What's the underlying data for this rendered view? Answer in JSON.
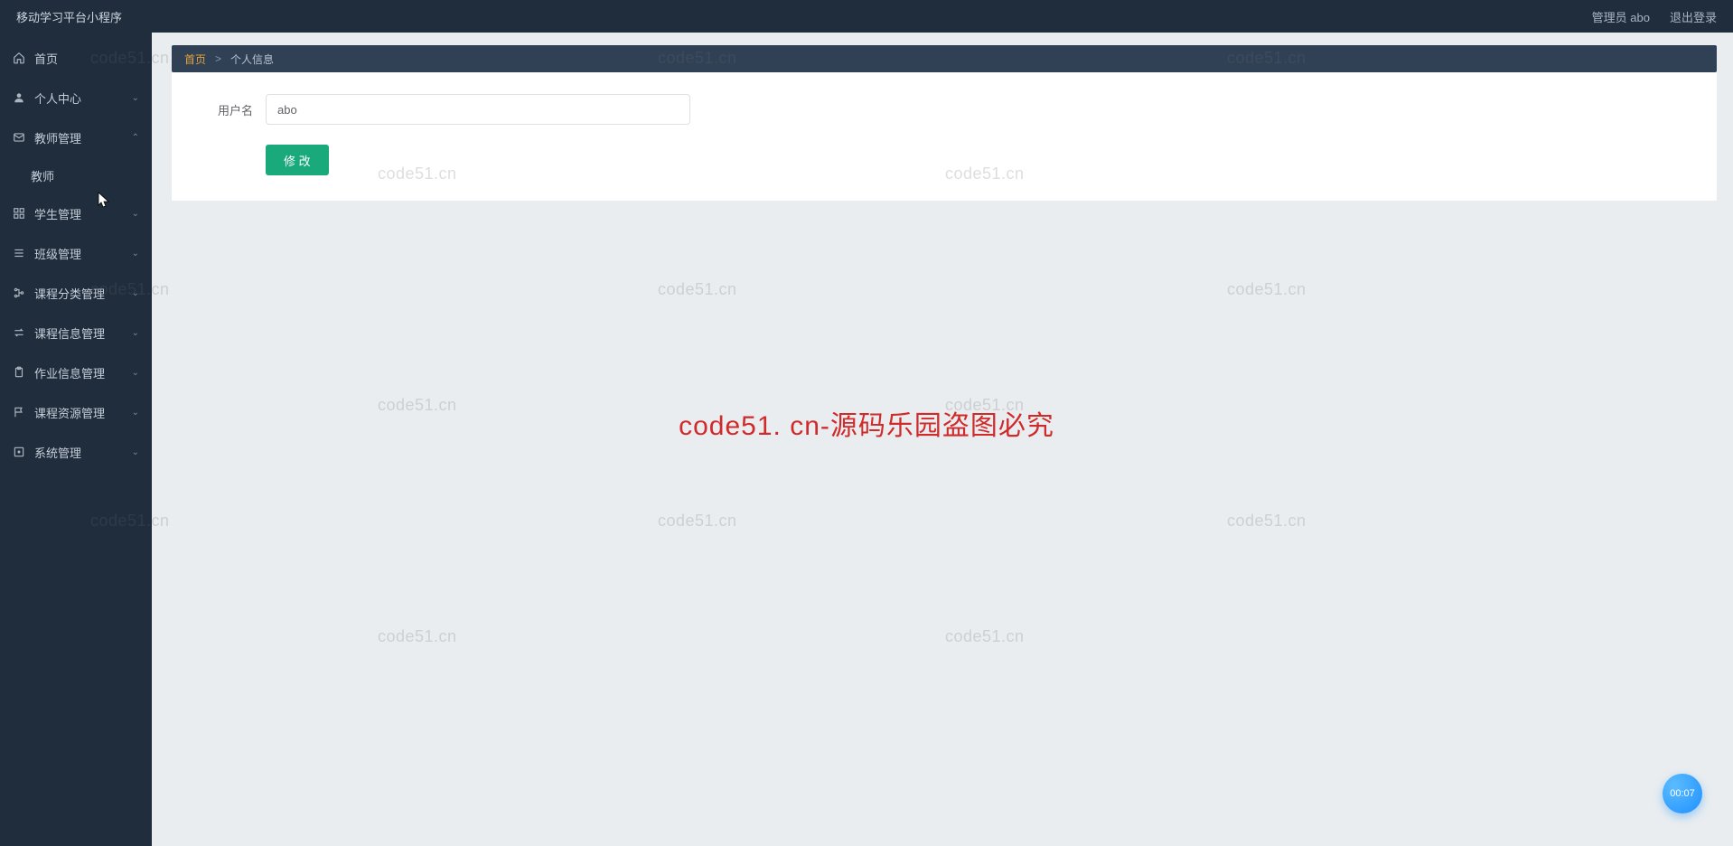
{
  "header": {
    "title": "移动学习平台小程序",
    "admin_label": "管理员 abo",
    "logout_label": "退出登录"
  },
  "sidebar": {
    "items": [
      {
        "icon": "home",
        "label": "首页",
        "expandable": false
      },
      {
        "icon": "user",
        "label": "个人中心",
        "expandable": true,
        "expanded": false
      },
      {
        "icon": "mail",
        "label": "教师管理",
        "expandable": true,
        "expanded": true,
        "children": [
          {
            "label": "教师"
          }
        ]
      },
      {
        "icon": "grid",
        "label": "学生管理",
        "expandable": true,
        "expanded": false
      },
      {
        "icon": "list",
        "label": "班级管理",
        "expandable": true,
        "expanded": false
      },
      {
        "icon": "tree",
        "label": "课程分类管理",
        "expandable": true,
        "expanded": false
      },
      {
        "icon": "swap",
        "label": "课程信息管理",
        "expandable": true,
        "expanded": false
      },
      {
        "icon": "clip",
        "label": "作业信息管理",
        "expandable": true,
        "expanded": false
      },
      {
        "icon": "flag",
        "label": "课程资源管理",
        "expandable": true,
        "expanded": false
      },
      {
        "icon": "square",
        "label": "系统管理",
        "expandable": true,
        "expanded": false
      }
    ]
  },
  "breadcrumb": {
    "home": "首页",
    "sep": ">",
    "current": "个人信息"
  },
  "form": {
    "username_label": "用户名",
    "username_value": "abo",
    "submit_label": "修 改"
  },
  "watermark": {
    "small": "code51.cn",
    "big": "code51. cn-源码乐园盗图必究"
  },
  "timer": "00:07"
}
